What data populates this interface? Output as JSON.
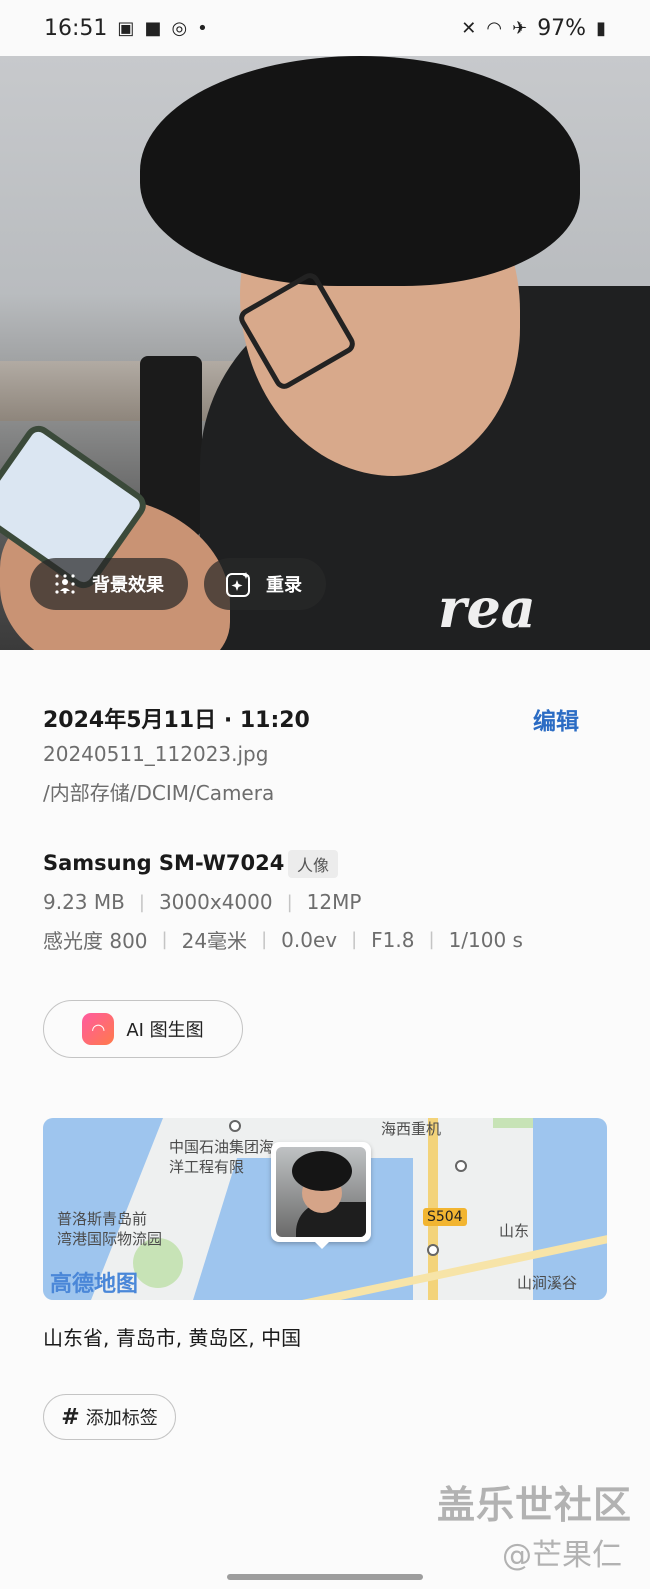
{
  "status_bar": {
    "time": "16:51",
    "battery": "97%",
    "left_icons": [
      "gallery-icon",
      "shopping-bag-icon",
      "weibo-icon",
      "dot-icon"
    ],
    "right_icons": [
      "mute-icon",
      "wifi-icon",
      "airplane-icon",
      "battery-icon"
    ]
  },
  "photo": {
    "actions": [
      {
        "label": "背景效果",
        "icon": "background-effect-icon"
      },
      {
        "label": "重录",
        "icon": "remaster-icon"
      }
    ]
  },
  "details": {
    "date": "2024年5月11日 · 11:20",
    "edit_label": "编辑",
    "filename": "20240511_112023.jpg",
    "path": "/内部存储/DCIM/Camera",
    "device": "Samsung SM-W7024",
    "mode_badge": "人像",
    "file_info": [
      "9.23 MB",
      "3000x4000",
      "12MP"
    ],
    "camera_info": [
      "感光度 800",
      "24毫米",
      "0.0ev",
      "F1.8",
      "1/100 s"
    ],
    "ai_button_label": "AI 图生图"
  },
  "map": {
    "brand": "高德地图",
    "road_label": "S504",
    "labels": {
      "company": "中国石油集团海",
      "company2": "洋工程有限",
      "haixi": "海西重机",
      "logistics": "普洛斯青岛前",
      "logistics2": "湾港国际物流园",
      "shandong": "山东",
      "shanjian": "山涧溪谷"
    }
  },
  "address": "山东省, 青岛市, 黄岛区, 中国",
  "add_tag_label": "添加标签",
  "watermark": {
    "line1": "盖乐世社区",
    "line2": "@芒果仁"
  }
}
